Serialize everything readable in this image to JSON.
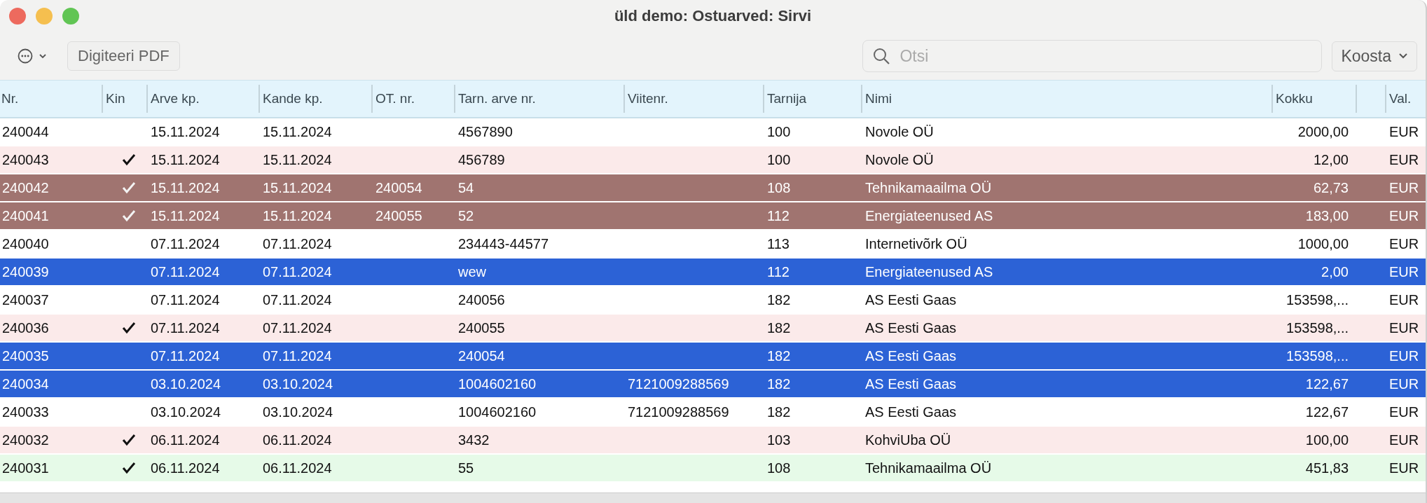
{
  "window": {
    "title": "üld demo: Ostuarved: Sirvi"
  },
  "toolbar": {
    "pdf_button": "Digiteeri PDF",
    "search": {
      "placeholder": "Otsi"
    },
    "compose_button": "Koosta"
  },
  "table": {
    "columns": [
      "Nr.",
      "Kin",
      "Arve kp.",
      "Kande kp.",
      "OT. nr.",
      "Tarn. arve nr.",
      "Viitenr.",
      "Tarnija",
      "Nimi",
      "Kokku",
      "Val."
    ],
    "rows": [
      {
        "nr": "240044",
        "checked": false,
        "arve_kp": "15.11.2024",
        "kande_kp": "15.11.2024",
        "ot_nr": "",
        "tarn_arve_nr": "4567890",
        "viitenr": "",
        "tarnija": "100",
        "nimi": "Novole OÜ",
        "kokku": "2000,00",
        "val": "EUR",
        "color": "#ffffff",
        "selected": false
      },
      {
        "nr": "240043",
        "checked": true,
        "arve_kp": "15.11.2024",
        "kande_kp": "15.11.2024",
        "ot_nr": "",
        "tarn_arve_nr": "456789",
        "viitenr": "",
        "tarnija": "100",
        "nimi": "Novole OÜ",
        "kokku": "12,00",
        "val": "EUR",
        "color": "#fbeaea",
        "selected": false
      },
      {
        "nr": "240042",
        "checked": true,
        "arve_kp": "15.11.2024",
        "kande_kp": "15.11.2024",
        "ot_nr": "240054",
        "tarn_arve_nr": "54",
        "viitenr": "",
        "tarnija": "108",
        "nimi": "Tehnikamaailma OÜ",
        "kokku": "62,73",
        "val": "EUR",
        "color": "#a07470",
        "selected": true
      },
      {
        "nr": "240041",
        "checked": true,
        "arve_kp": "15.11.2024",
        "kande_kp": "15.11.2024",
        "ot_nr": "240055",
        "tarn_arve_nr": "52",
        "viitenr": "",
        "tarnija": "112",
        "nimi": "Energiateenused AS",
        "kokku": "183,00",
        "val": "EUR",
        "color": "#a07470",
        "selected": true
      },
      {
        "nr": "240040",
        "checked": false,
        "arve_kp": "07.11.2024",
        "kande_kp": "07.11.2024",
        "ot_nr": "",
        "tarn_arve_nr": "234443-44577",
        "viitenr": "",
        "tarnija": "113",
        "nimi": "Internetivõrk OÜ",
        "kokku": "1000,00",
        "val": "EUR",
        "color": "#ffffff",
        "selected": false
      },
      {
        "nr": "240039",
        "checked": false,
        "arve_kp": "07.11.2024",
        "kande_kp": "07.11.2024",
        "ot_nr": "",
        "tarn_arve_nr": "wew",
        "viitenr": "",
        "tarnija": "112",
        "nimi": "Energiateenused AS",
        "kokku": "2,00",
        "val": "EUR",
        "color": "#2c62d6",
        "selected": true
      },
      {
        "nr": "240037",
        "checked": false,
        "arve_kp": "07.11.2024",
        "kande_kp": "07.11.2024",
        "ot_nr": "",
        "tarn_arve_nr": "240056",
        "viitenr": "",
        "tarnija": "182",
        "nimi": "AS Eesti Gaas",
        "kokku": "153598,...",
        "val": "EUR",
        "color": "#ffffff",
        "selected": false
      },
      {
        "nr": "240036",
        "checked": true,
        "arve_kp": "07.11.2024",
        "kande_kp": "07.11.2024",
        "ot_nr": "",
        "tarn_arve_nr": "240055",
        "viitenr": "",
        "tarnija": "182",
        "nimi": "AS Eesti Gaas",
        "kokku": "153598,...",
        "val": "EUR",
        "color": "#fbeaea",
        "selected": false
      },
      {
        "nr": "240035",
        "checked": false,
        "arve_kp": "07.11.2024",
        "kande_kp": "07.11.2024",
        "ot_nr": "",
        "tarn_arve_nr": "240054",
        "viitenr": "",
        "tarnija": "182",
        "nimi": "AS Eesti Gaas",
        "kokku": "153598,...",
        "val": "EUR",
        "color": "#2c62d6",
        "selected": true
      },
      {
        "nr": "240034",
        "checked": false,
        "arve_kp": "03.10.2024",
        "kande_kp": "03.10.2024",
        "ot_nr": "",
        "tarn_arve_nr": "1004602160",
        "viitenr": "7121009288569",
        "tarnija": "182",
        "nimi": "AS Eesti Gaas",
        "kokku": "122,67",
        "val": "EUR",
        "color": "#2c62d6",
        "selected": true
      },
      {
        "nr": "240033",
        "checked": false,
        "arve_kp": "03.10.2024",
        "kande_kp": "03.10.2024",
        "ot_nr": "",
        "tarn_arve_nr": "1004602160",
        "viitenr": "7121009288569",
        "tarnija": "182",
        "nimi": "AS Eesti Gaas",
        "kokku": "122,67",
        "val": "EUR",
        "color": "#ffffff",
        "selected": false
      },
      {
        "nr": "240032",
        "checked": true,
        "arve_kp": "06.11.2024",
        "kande_kp": "06.11.2024",
        "ot_nr": "",
        "tarn_arve_nr": "3432",
        "viitenr": "",
        "tarnija": "103",
        "nimi": "KohviUba OÜ",
        "kokku": "100,00",
        "val": "EUR",
        "color": "#fbeaea",
        "selected": false
      },
      {
        "nr": "240031",
        "checked": true,
        "arve_kp": "06.11.2024",
        "kande_kp": "06.11.2024",
        "ot_nr": "",
        "tarn_arve_nr": "55",
        "viitenr": "",
        "tarnija": "108",
        "nimi": "Tehnikamaailma OÜ",
        "kokku": "451,83",
        "val": "EUR",
        "color": "#e6fae8",
        "selected": false
      }
    ]
  }
}
